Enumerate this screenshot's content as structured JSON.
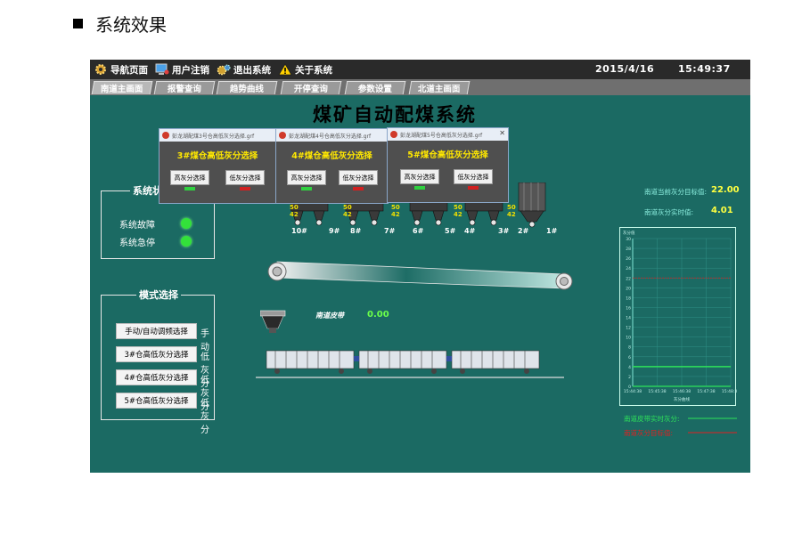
{
  "doc": {
    "heading": "系统效果"
  },
  "topbar": {
    "menu": [
      {
        "label": "导航页面",
        "icon": "gear-icon"
      },
      {
        "label": "用户注销",
        "icon": "computer-icon"
      },
      {
        "label": "退出系统",
        "icon": "gears-icon"
      },
      {
        "label": "关于系统",
        "icon": "warning-icon"
      }
    ],
    "date": "2015/4/16",
    "time": "15:49:37"
  },
  "tabs": [
    "南道主画面",
    "报警查询",
    "趋势曲线",
    "开停查询",
    "参数设置",
    "北道主画面"
  ],
  "title": "煤矿自动配煤系统",
  "dialogs": [
    {
      "caption": "彭龙湖配煤3号仓高低灰分选择.grf",
      "heading": "3#煤仓高低灰分选择",
      "btn_high": "高灰分选择",
      "btn_low": "低灰分选择"
    },
    {
      "caption": "彭龙湖配煤4号仓高低灰分选择.grf",
      "heading": "4#煤仓高低灰分选择",
      "btn_high": "高灰分选择",
      "btn_low": "低灰分选择"
    },
    {
      "caption": "彭龙湖配煤5号仓高低灰分选择.grf",
      "heading": "5#煤仓高低灰分选择",
      "btn_high": "高灰分选择",
      "btn_low": "低灰分选择"
    }
  ],
  "status_panel": {
    "title": "系统状态",
    "fault": "系统故障",
    "estop": "系统急停"
  },
  "mode_panel": {
    "title": "模式选择",
    "rows": [
      {
        "button": "手动/自动调频选择",
        "value": "手动"
      },
      {
        "button": "3#仓高低灰分选择",
        "value": "低灰分"
      },
      {
        "button": "4#仓高低灰分选择",
        "value": "低灰分"
      },
      {
        "button": "5#仓高低灰分选择",
        "value": "低灰分"
      }
    ]
  },
  "bins": {
    "numbers": [
      "10#",
      "9#",
      "8#",
      "7#",
      "6#",
      "5#",
      "4#",
      "3#",
      "2#",
      "1#"
    ],
    "top_vals": [
      "50",
      "50",
      "50",
      "50",
      "50"
    ],
    "mid_vals": [
      "42",
      "42",
      "42",
      "42",
      "42"
    ]
  },
  "belt": {
    "label": "南道皮带",
    "value": "0.00"
  },
  "readings": [
    {
      "label": "南道当前灰分目标值:",
      "value": "22.00"
    },
    {
      "label": "南道灰分实时值:",
      "value": "4.01"
    }
  ],
  "chart_data": {
    "type": "line",
    "title": "",
    "ylabel": "灰分值",
    "xlabel": "灰分曲线",
    "x": [
      "15:44:38",
      "15:45:38",
      "15:46:38",
      "15:47:38",
      "15:48:38"
    ],
    "y_ticks": [
      "30",
      "28",
      "26",
      "24",
      "22",
      "20",
      "18",
      "16",
      "14",
      "12",
      "10",
      "8",
      "6",
      "4",
      "2",
      "0"
    ],
    "ylim": [
      0,
      30
    ],
    "grid": true,
    "series": [
      {
        "name": "南道皮带实时灰分:",
        "color": "#2ee35a",
        "values": [
          4.0,
          4.0,
          4.0,
          4.0,
          4.0
        ]
      },
      {
        "name": "南道灰分目标值:",
        "color": "#e02020",
        "values": [
          22,
          22,
          22,
          22,
          22
        ]
      }
    ]
  }
}
